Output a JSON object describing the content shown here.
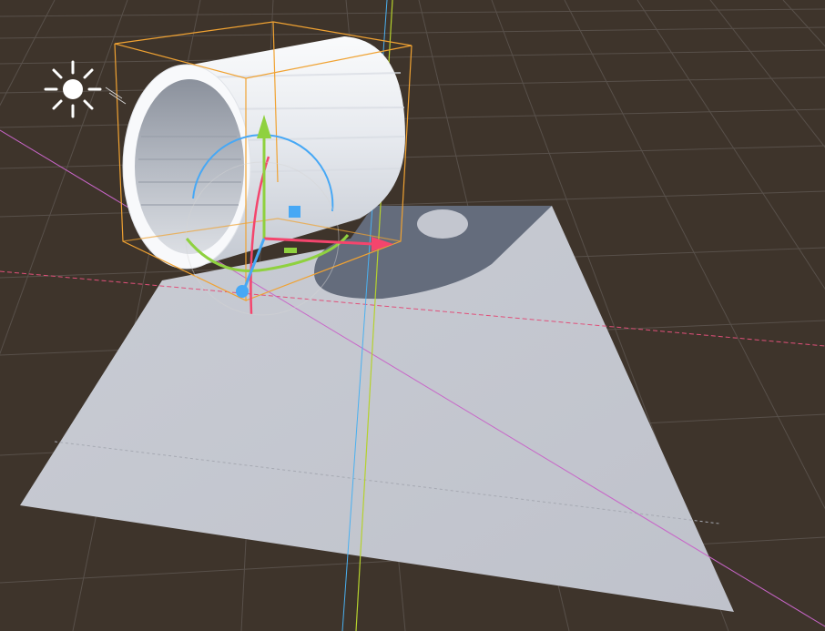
{
  "viewport": {
    "kind": "3D scene view",
    "background_color": "#3e342b",
    "grid_color": "#58504a"
  },
  "scene": {
    "light": {
      "icon": "sun-icon",
      "color": "#ffffff"
    },
    "ground_plane": {
      "color": "#c3c6cf",
      "shadow_color": "#646c7c"
    },
    "selected_object": {
      "shape": "hollow cylinder (tube)",
      "color": "#f2f4f7",
      "selection_outline_color": "#f0a232"
    }
  },
  "gizmo": {
    "x_axis_color": "#f4456d",
    "y_axis_color": "#8fd13f",
    "z_axis_color": "#47a8f5",
    "rotation_ring_colors": [
      "#47a8f5",
      "#8fd13f",
      "#f4456d"
    ]
  },
  "world_axes": {
    "x_line_color": "#e0507a",
    "y_line_color": "#b5d12d",
    "z_line_color": "#4ab0f0",
    "diagonal_line_color": "#c865c8"
  }
}
